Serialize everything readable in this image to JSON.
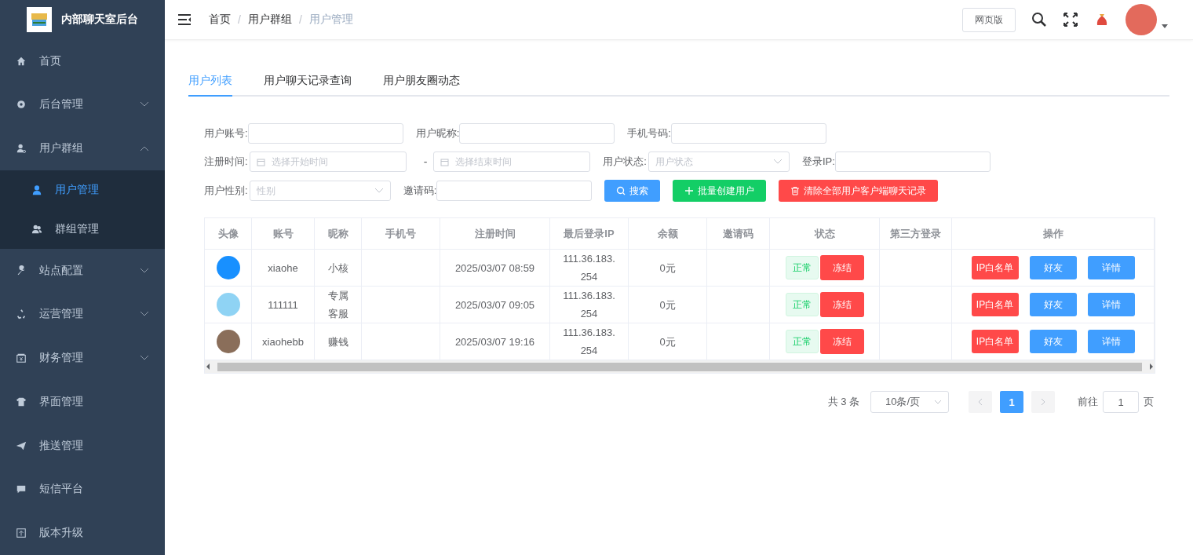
{
  "sidebar": {
    "title": "内部聊天室后台",
    "items": [
      {
        "label": "首页",
        "selected": false
      },
      {
        "label": "后台管理",
        "expanded": false,
        "selected": false
      },
      {
        "label": "用户群组",
        "expanded": true,
        "selected": false,
        "children": [
          {
            "label": "用户管理",
            "selected": true
          },
          {
            "label": "群组管理",
            "selected": false
          }
        ]
      },
      {
        "label": "站点配置",
        "expanded": false,
        "selected": false
      },
      {
        "label": "运营管理",
        "expanded": false,
        "selected": false
      },
      {
        "label": "财务管理",
        "expanded": false,
        "selected": false
      },
      {
        "label": "界面管理",
        "selected": false
      },
      {
        "label": "推送管理",
        "selected": false
      },
      {
        "label": "短信平台",
        "selected": false
      },
      {
        "label": "版本升级",
        "selected": false
      }
    ]
  },
  "header": {
    "breadcrumb": [
      {
        "label": "首页",
        "current": false
      },
      {
        "separator": "/",
        "label": "用户群组",
        "current": false
      },
      {
        "separator": "/",
        "label": "用户管理",
        "current": true
      }
    ],
    "web_button": "网页版"
  },
  "tabs": [
    {
      "label": "用户列表",
      "selected": true
    },
    {
      "label": "用户聊天记录查询",
      "selected": false
    },
    {
      "label": "用户朋友圈动态",
      "selected": false
    }
  ],
  "filters": [
    [
      {
        "kind": "text",
        "label": "用户账号:"
      },
      {
        "kind": "text",
        "label": "用户昵称:"
      },
      {
        "kind": "text",
        "label": "手机号码:"
      }
    ],
    [
      {
        "kind": "date",
        "label": "注册时间:",
        "placeholder": "选择开始时间"
      },
      {
        "kind": "sep",
        "label": "-"
      },
      {
        "kind": "date",
        "placeholder": "选择结束时间"
      },
      {
        "kind": "select",
        "label": "用户状态:",
        "placeholder": "用户状态"
      },
      {
        "kind": "text",
        "label": "登录IP:"
      }
    ],
    [
      {
        "kind": "select",
        "label": "用户性别:",
        "placeholder": "性别"
      },
      {
        "kind": "text",
        "label": "邀请码:"
      },
      {
        "kind": "button",
        "label": "搜索"
      },
      {
        "kind": "button",
        "label": "批量创建用户"
      },
      {
        "kind": "button",
        "label": "清除全部用户客户端聊天记录"
      }
    ]
  ],
  "table": {
    "columns": [
      "头像",
      "账号",
      "昵称",
      "手机号",
      "注册时间",
      "最后登录IP",
      "余额",
      "邀请码",
      "状态",
      "第三方登录",
      "操作"
    ],
    "rows": [
      {
        "account": "xiaohe",
        "nickname": "小核",
        "registered": "2025/03/07 08:59",
        "last_ip": "111.36.183.\n254",
        "balance": "0元",
        "status": "正常",
        "status_action": "冻结",
        "actions": [
          "IP白名单",
          "好友",
          "详情"
        ]
      },
      {
        "account": "111111",
        "nickname": "专属客服",
        "registered": "2025/03/07 09:05",
        "last_ip": "111.36.183.\n254",
        "balance": "0元",
        "status": "正常",
        "status_action": "冻结",
        "actions": [
          "IP白名单",
          "好友",
          "详情"
        ]
      },
      {
        "account": "xiaohebb",
        "nickname": "赚钱",
        "registered": "2025/03/07 19:16",
        "last_ip": "111.36.183.\n254",
        "balance": "0元",
        "status": "正常",
        "status_action": "冻结",
        "actions": [
          "IP白名单",
          "好友",
          "详情"
        ]
      }
    ]
  },
  "pagination": {
    "total": "共 3 条",
    "page_size": "10条/页",
    "pages": [
      {
        "label": "1",
        "selected": true
      }
    ],
    "goto_label": "前往",
    "goto_value": "1",
    "goto_suffix": "页"
  }
}
